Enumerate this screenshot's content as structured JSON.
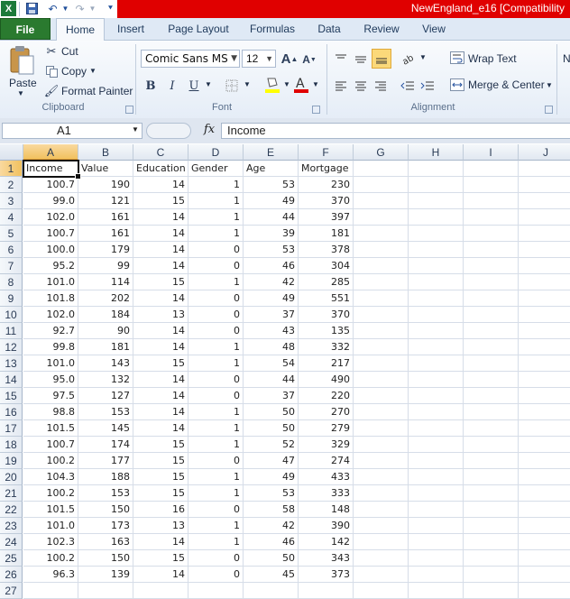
{
  "title": "NewEngland_e16  [Compatibility",
  "colors": {
    "title_bar": "#e00000",
    "file_tab": "#2a7a2f",
    "selection_header": "#f1c15f"
  },
  "quick_access": {
    "icons": [
      "excel-icon",
      "save-icon",
      "undo-icon",
      "redo-icon",
      "customize-icon"
    ]
  },
  "tabs": [
    {
      "label": "File"
    },
    {
      "label": "Home"
    },
    {
      "label": "Insert"
    },
    {
      "label": "Page Layout"
    },
    {
      "label": "Formulas"
    },
    {
      "label": "Data"
    },
    {
      "label": "Review"
    },
    {
      "label": "View"
    }
  ],
  "ribbon": {
    "clipboard": {
      "paste": "Paste",
      "cut": "Cut",
      "copy": "Copy",
      "format_painter": "Format Painter",
      "label": "Clipboard"
    },
    "font": {
      "font_name": "Comic Sans MS",
      "font_size": "12",
      "bold": "B",
      "italic": "I",
      "underline": "U",
      "label": "Font"
    },
    "alignment": {
      "wrap_text": "Wrap Text",
      "merge_center": "Merge & Center",
      "label": "Alignment"
    },
    "number": {
      "partial": "N"
    }
  },
  "formula_bar": {
    "name_box": "A1",
    "fx": "fx",
    "content": "Income"
  },
  "grid": {
    "columns": [
      "A",
      "B",
      "C",
      "D",
      "E",
      "F",
      "G",
      "H",
      "I",
      "J"
    ],
    "selected_column": "A",
    "selected_row": "1",
    "row_numbers": [
      "1",
      "2",
      "3",
      "4",
      "5",
      "6",
      "7",
      "8",
      "9",
      "10",
      "11",
      "12",
      "13",
      "14",
      "15",
      "16",
      "17",
      "18",
      "19",
      "20",
      "21",
      "22",
      "23",
      "24",
      "25",
      "26",
      "27"
    ],
    "headers": [
      "Income",
      "Value",
      "Education",
      "Gender",
      "Age",
      "Mortgage"
    ],
    "rows": [
      [
        "100.7",
        "190",
        "14",
        "1",
        "53",
        "230"
      ],
      [
        "99.0",
        "121",
        "15",
        "1",
        "49",
        "370"
      ],
      [
        "102.0",
        "161",
        "14",
        "1",
        "44",
        "397"
      ],
      [
        "100.7",
        "161",
        "14",
        "1",
        "39",
        "181"
      ],
      [
        "100.0",
        "179",
        "14",
        "0",
        "53",
        "378"
      ],
      [
        "95.2",
        "99",
        "14",
        "0",
        "46",
        "304"
      ],
      [
        "101.0",
        "114",
        "15",
        "1",
        "42",
        "285"
      ],
      [
        "101.8",
        "202",
        "14",
        "0",
        "49",
        "551"
      ],
      [
        "102.0",
        "184",
        "13",
        "0",
        "37",
        "370"
      ],
      [
        "92.7",
        "90",
        "14",
        "0",
        "43",
        "135"
      ],
      [
        "99.8",
        "181",
        "14",
        "1",
        "48",
        "332"
      ],
      [
        "101.0",
        "143",
        "15",
        "1",
        "54",
        "217"
      ],
      [
        "95.0",
        "132",
        "14",
        "0",
        "44",
        "490"
      ],
      [
        "97.5",
        "127",
        "14",
        "0",
        "37",
        "220"
      ],
      [
        "98.8",
        "153",
        "14",
        "1",
        "50",
        "270"
      ],
      [
        "101.5",
        "145",
        "14",
        "1",
        "50",
        "279"
      ],
      [
        "100.7",
        "174",
        "15",
        "1",
        "52",
        "329"
      ],
      [
        "100.2",
        "177",
        "15",
        "0",
        "47",
        "274"
      ],
      [
        "104.3",
        "188",
        "15",
        "1",
        "49",
        "433"
      ],
      [
        "100.2",
        "153",
        "15",
        "1",
        "53",
        "333"
      ],
      [
        "101.5",
        "150",
        "16",
        "0",
        "58",
        "148"
      ],
      [
        "101.0",
        "173",
        "13",
        "1",
        "42",
        "390"
      ],
      [
        "102.3",
        "163",
        "14",
        "1",
        "46",
        "142"
      ],
      [
        "100.2",
        "150",
        "15",
        "0",
        "50",
        "343"
      ],
      [
        "96.3",
        "139",
        "14",
        "0",
        "45",
        "373"
      ]
    ]
  }
}
